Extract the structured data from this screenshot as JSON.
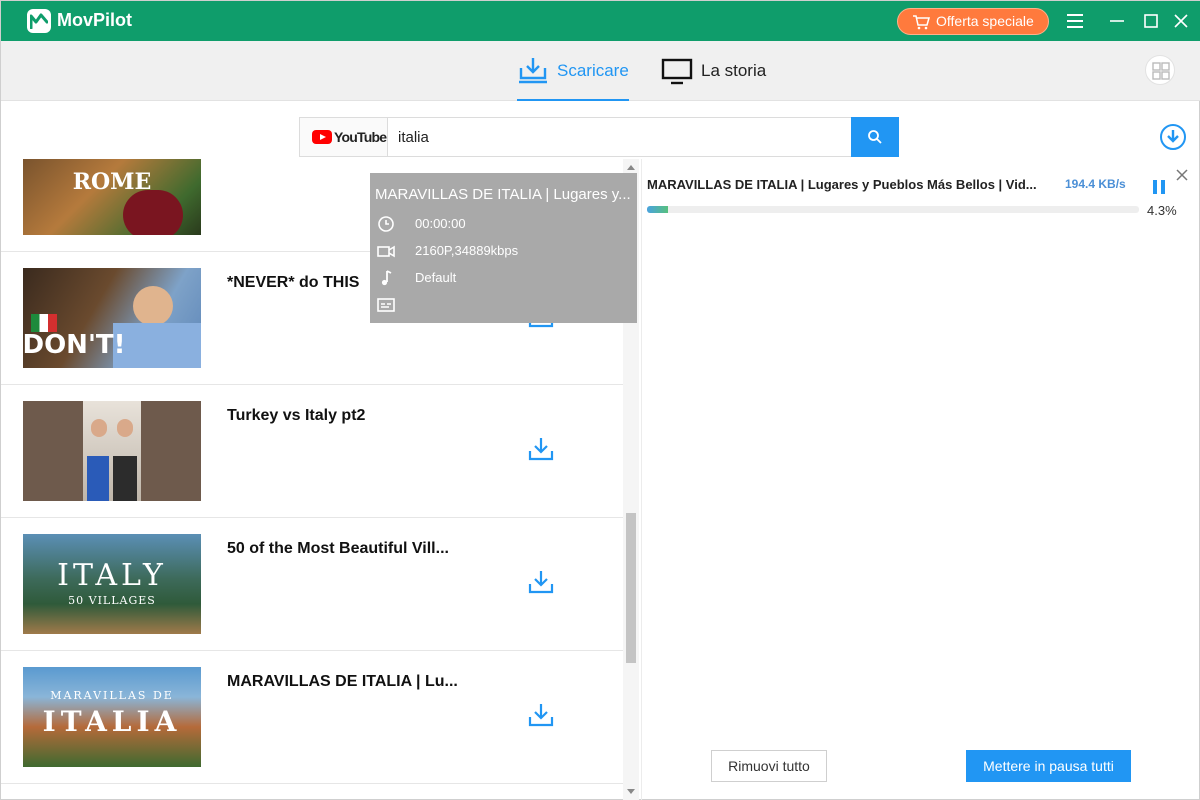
{
  "app": {
    "name": "MovPilot"
  },
  "titlebar": {
    "offer_label": "Offerta speciale"
  },
  "nav": {
    "tabs": [
      {
        "label": "Scaricare",
        "active": true
      },
      {
        "label": "La storia",
        "active": false
      }
    ]
  },
  "search": {
    "platform": "YouTube",
    "value": "italia"
  },
  "results": [
    {
      "title": "",
      "thumb_text": "ROME"
    },
    {
      "title": "*NEVER* do THIS",
      "thumb_text": "DON'T!"
    },
    {
      "title": "Turkey vs Italy pt2",
      "thumb_text": ""
    },
    {
      "title": "50 of the Most Beautiful Vill...",
      "thumb_text": "ITALY",
      "thumb_sub": "50 VILLAGES"
    },
    {
      "title": "MARAVILLAS DE ITALIA | Lu...",
      "thumb_text": "ITALIA",
      "thumb_sub": "MARAVILLAS DE"
    }
  ],
  "tooltip": {
    "title": "MARAVILLAS DE ITALIA | Lugares y...",
    "duration": "00:00:00",
    "video": "2160P,34889kbps",
    "audio": "Default",
    "subtitle": ""
  },
  "download": {
    "title": "MARAVILLAS DE ITALIA | Lugares y Pueblos Más Bellos | Vid...",
    "speed": "194.4 KB/s",
    "percent_label": "4.3%",
    "progress": 0.043
  },
  "actions": {
    "remove_all": "Rimuovi tutto",
    "pause_all": "Mettere in pausa tutti"
  },
  "colors": {
    "titlebar": "#0f9d6b",
    "accent": "#2196f3",
    "offer": "#ff7a3d"
  }
}
